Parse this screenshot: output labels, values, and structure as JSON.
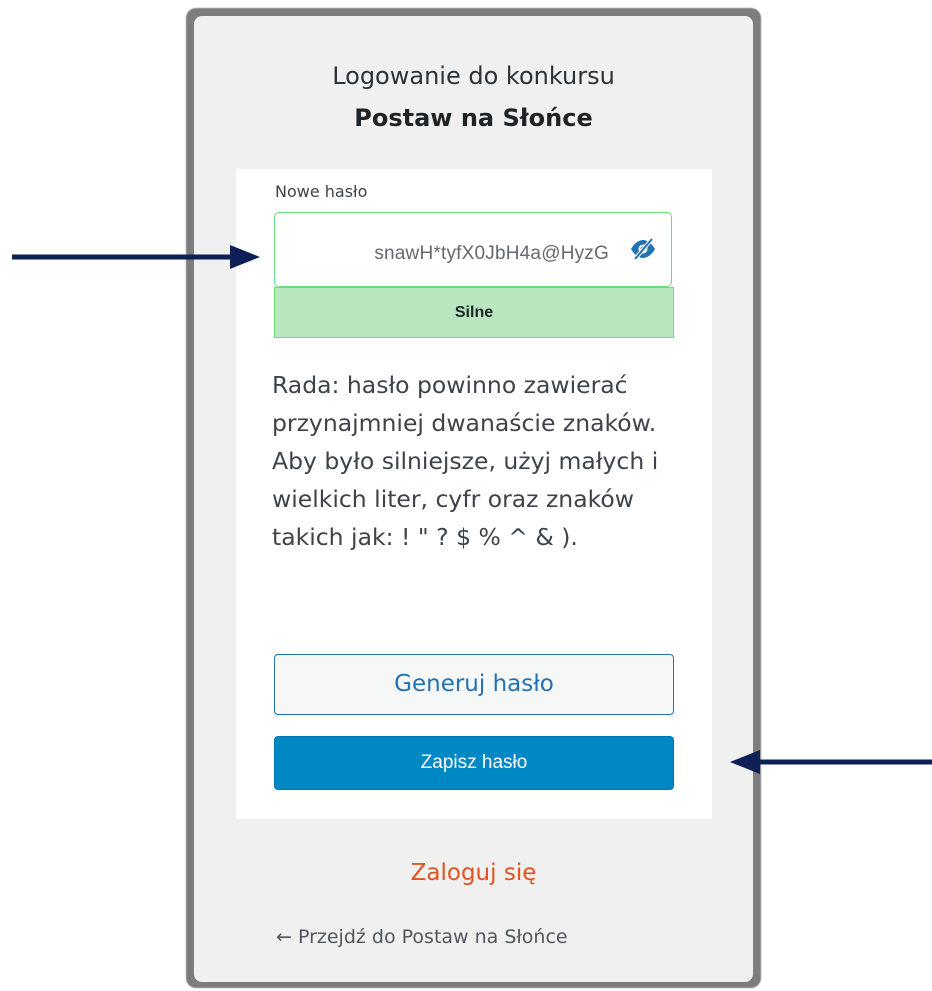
{
  "header": {
    "title_line1": "Logowanie do konkursu",
    "title_line2": "Postaw na Słońce"
  },
  "form": {
    "new_password_label": "Nowe hasło",
    "password_value": "snawH*tyfX0JbH4a@HyzG",
    "visibility_icon": "eye-slash-icon",
    "strength_label": "Silne",
    "hint": "Rada: hasło powinno zawierać przynajmniej dwanaście znaków. Aby było silniejsze, użyj małych i wielkich liter, cyfr oraz znaków takich jak: ! \" ? $ % ^ & ).",
    "generate_button": "Generuj hasło",
    "save_button": "Zapisz hasło"
  },
  "links": {
    "login": "Zaloguj się",
    "back": "← Przejdź do Postaw na Słońce"
  },
  "annotations": {
    "arrow_color": "#0d1f55"
  },
  "colors": {
    "accent": "#2271b1",
    "save_button": "#0088c5",
    "strength_bg": "#b8e6bf",
    "strength_border": "#68de7c",
    "login_link": "#e5511f"
  }
}
